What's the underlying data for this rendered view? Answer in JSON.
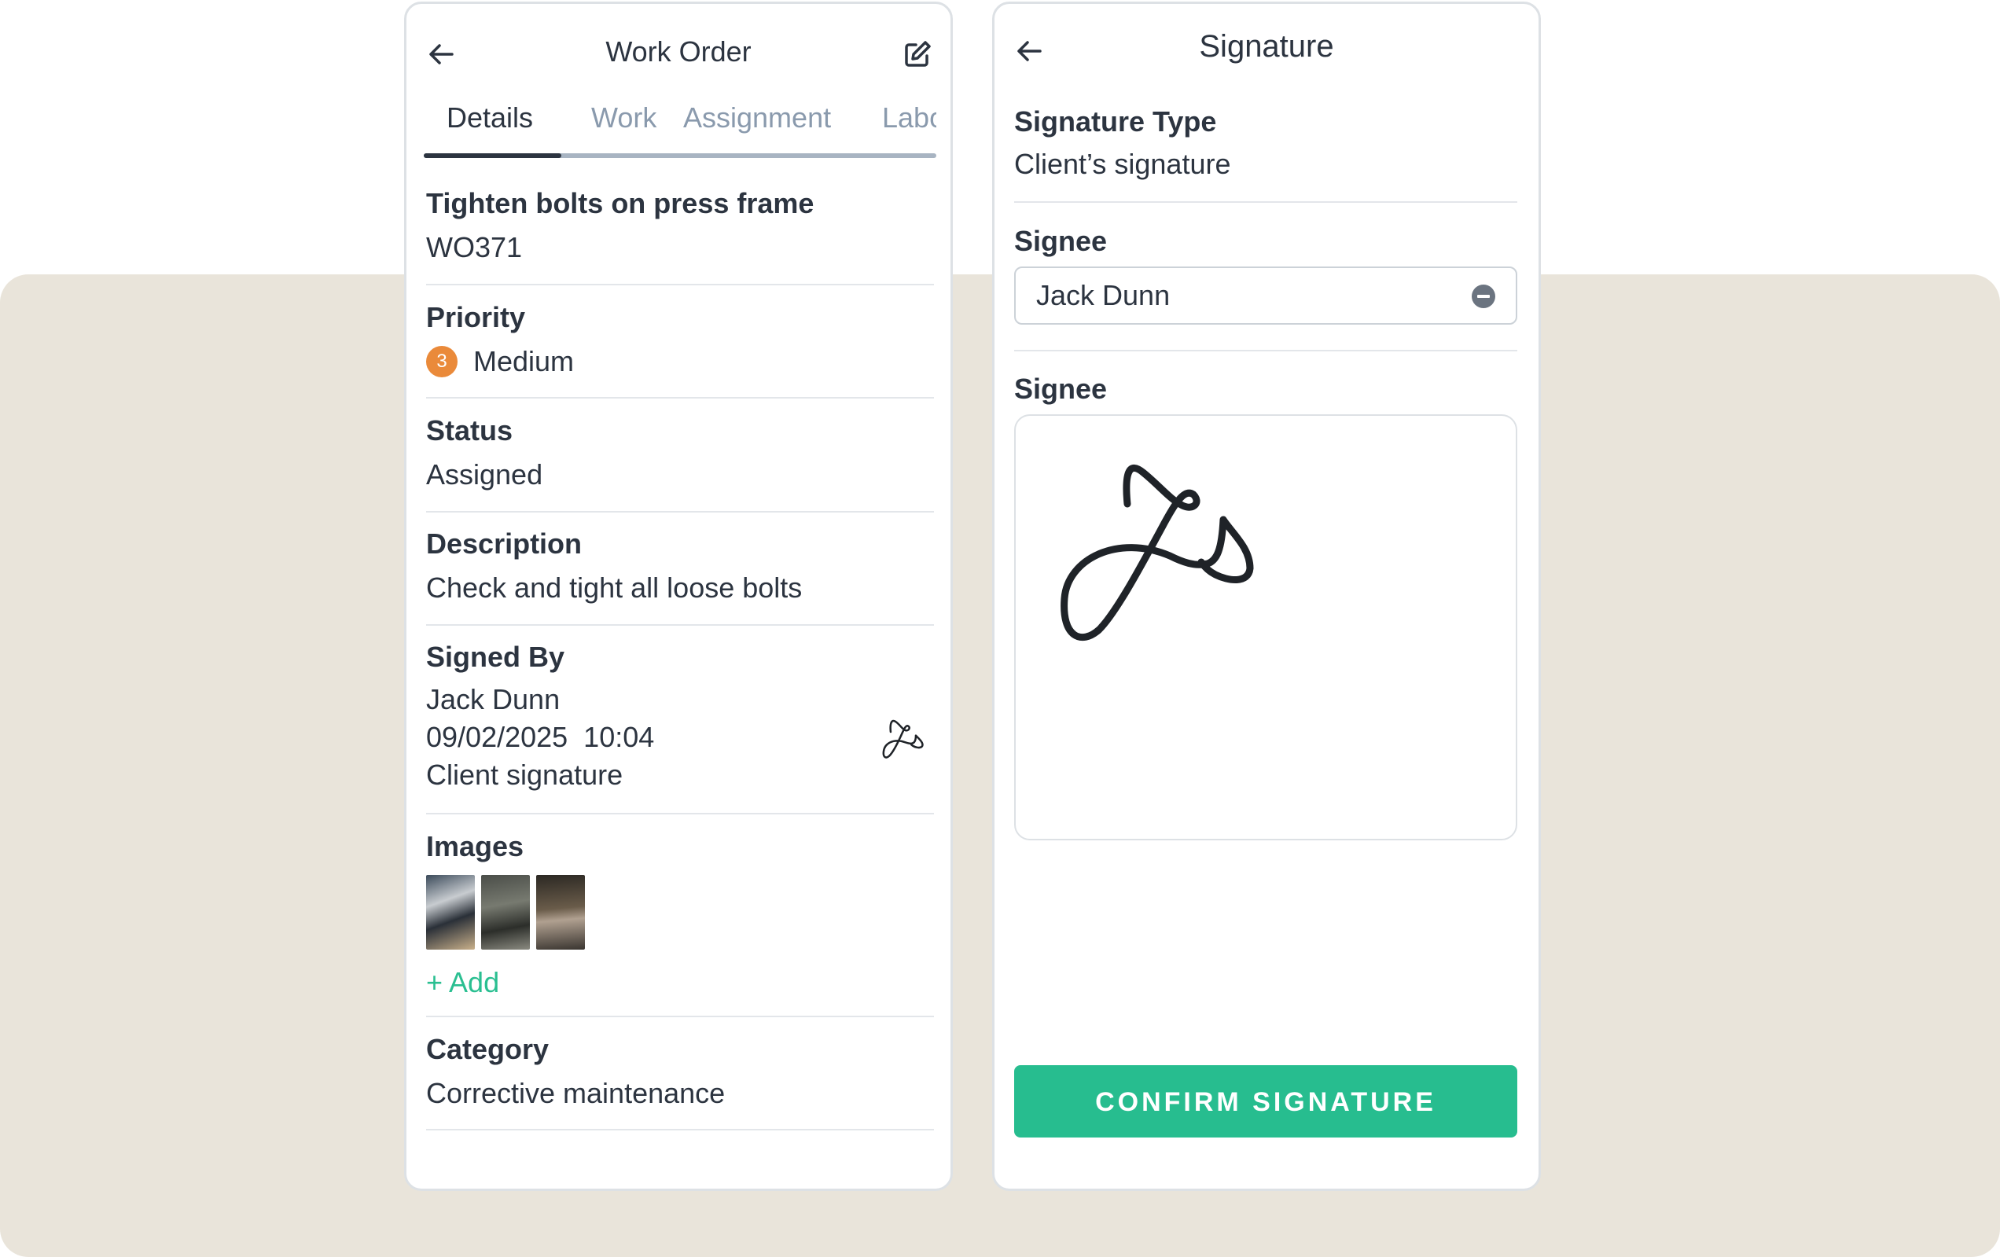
{
  "work_order": {
    "title": "Work Order",
    "tabs": [
      "Details",
      "Work",
      "Assignment",
      "Labor"
    ],
    "active_tab": "Details",
    "name": "Tighten bolts on press frame",
    "code": "WO371",
    "priority_label": "Priority",
    "priority_level": "3",
    "priority_value": "Medium",
    "status_label": "Status",
    "status_value": "Assigned",
    "description_label": "Description",
    "description_value": "Check and tight all loose bolts",
    "signed_by_label": "Signed By",
    "signed_by_name": "Jack Dunn",
    "signed_by_datetime": "09/02/2025  10:04",
    "signed_by_type": "Client signature",
    "images_label": "Images",
    "add_label": "+ Add",
    "category_label": "Category",
    "category_value": "Corrective maintenance"
  },
  "signature": {
    "title": "Signature",
    "type_label": "Signature Type",
    "type_value": "Client’s signature",
    "signee_label": "Signee",
    "signee_value": "Jack Dunn",
    "pad_label": "Signee",
    "confirm_label": "CONFIRM SIGNATURE"
  },
  "colors": {
    "accent_green": "#27bd8f",
    "priority_orange": "#ea8a3a",
    "background_beige": "#e9e4da",
    "text_dark": "#2c3440",
    "tab_inactive": "#8a9aad"
  },
  "icons": {
    "back": "arrow-left-icon",
    "edit": "edit-icon",
    "clear": "clear-circle-icon"
  }
}
